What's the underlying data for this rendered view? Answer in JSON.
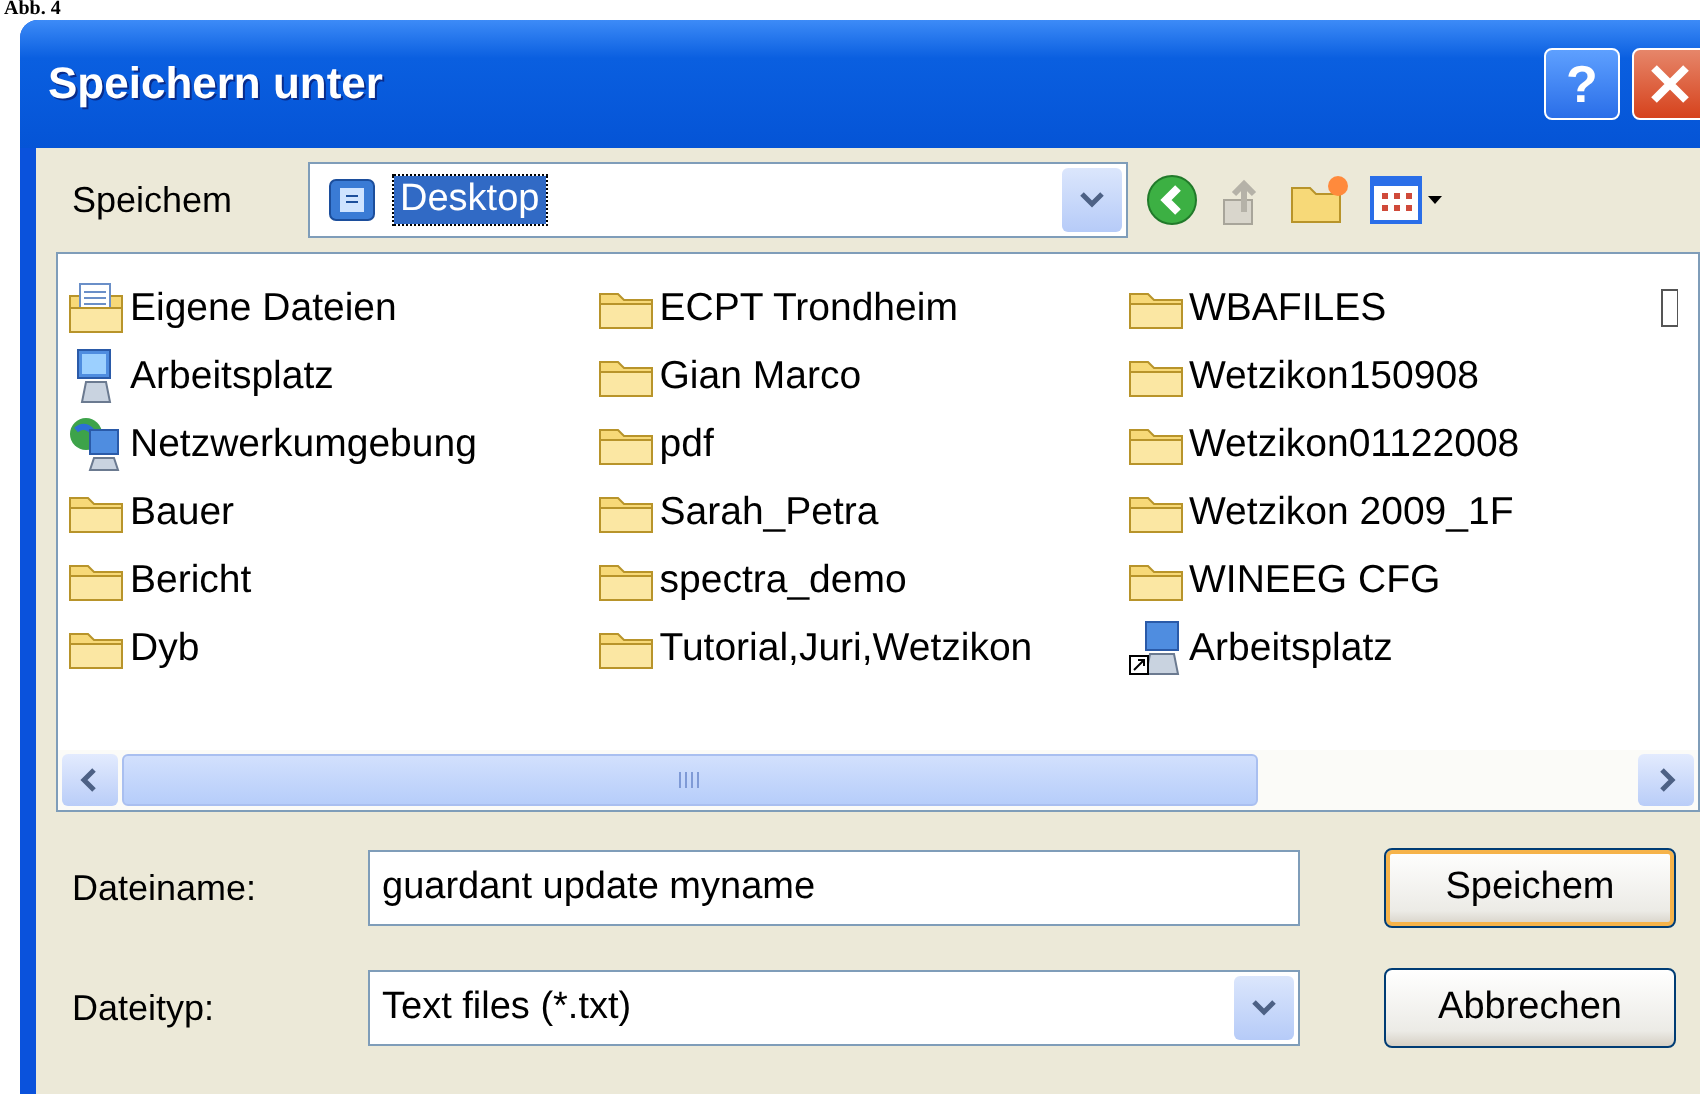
{
  "caption": "Abb. 4",
  "window": {
    "title": "Speichern unter",
    "help_button": "?"
  },
  "save_in": {
    "label": "Speichem",
    "location": "Desktop",
    "selected": true
  },
  "file_list": {
    "columns": [
      {
        "items": [
          {
            "name": "Eigene Dateien",
            "kind": "documents"
          },
          {
            "name": "Arbeitsplatz",
            "kind": "computer"
          },
          {
            "name": "Netzwerkumgebung",
            "kind": "network"
          },
          {
            "name": "Bauer",
            "kind": "folder"
          },
          {
            "name": "Bericht",
            "kind": "folder"
          },
          {
            "name": "Dyb",
            "kind": "folder"
          }
        ]
      },
      {
        "items": [
          {
            "name": "ECPT Trondheim",
            "kind": "folder"
          },
          {
            "name": "Gian Marco",
            "kind": "folder"
          },
          {
            "name": "pdf",
            "kind": "folder"
          },
          {
            "name": "Sarah_Petra",
            "kind": "folder"
          },
          {
            "name": "spectra_demo",
            "kind": "folder"
          },
          {
            "name": "Tutorial,Juri,Wetzikon",
            "kind": "folder"
          }
        ]
      },
      {
        "items": [
          {
            "name": "WBAFILES",
            "kind": "folder"
          },
          {
            "name": "Wetzikon150908",
            "kind": "folder"
          },
          {
            "name": "Wetzikon01122008",
            "kind": "folder"
          },
          {
            "name": "Wetzikon 2009_1F",
            "kind": "folder"
          },
          {
            "name": "WINEEG CFG",
            "kind": "folder"
          },
          {
            "name": "Arbeitsplatz",
            "kind": "computer-shortcut"
          }
        ]
      }
    ]
  },
  "file_name": {
    "label": "Dateiname:",
    "value": "guardant update myname"
  },
  "file_type": {
    "label": "Dateityp:",
    "value": "Text files (*.txt)"
  },
  "buttons": [
    {
      "label": "Speichem",
      "default": true
    },
    {
      "label": "Abbrechen",
      "default": false
    }
  ]
}
